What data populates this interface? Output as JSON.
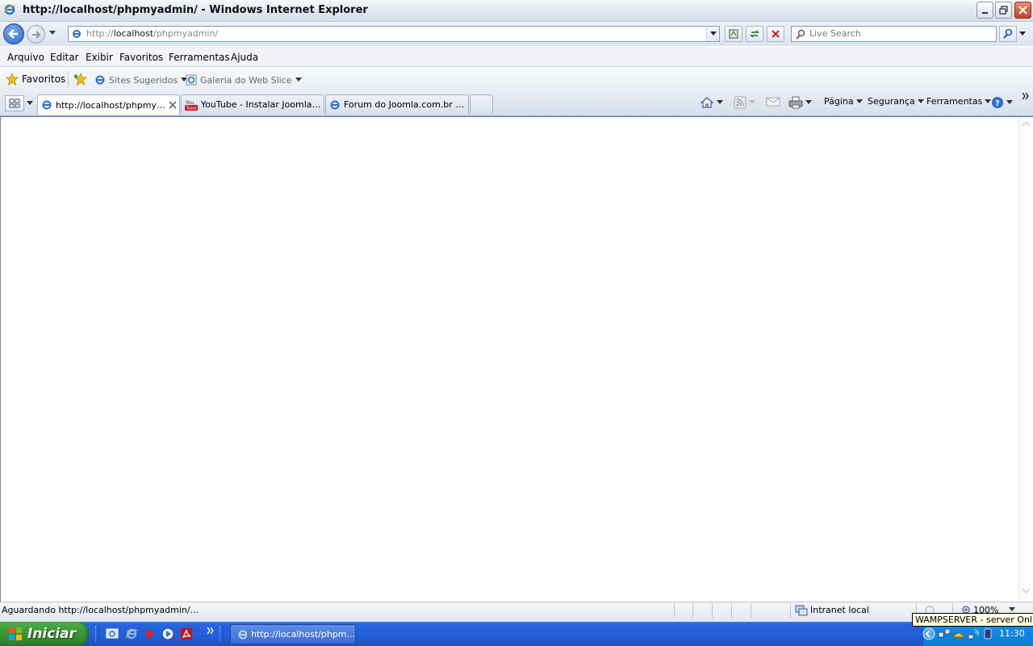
{
  "window": {
    "title": "http://localhost/phpmyadmin/ - Windows Internet Explorer"
  },
  "address": {
    "prefix": "http://",
    "host": "localhost",
    "path": "/phpmyadmin/"
  },
  "search": {
    "placeholder": "Live Search"
  },
  "menu": [
    "Arquivo",
    "Editar",
    "Exibir",
    "Favoritos",
    "Ferramentas",
    "Ajuda"
  ],
  "favorites_bar": {
    "favorites_label": "Favoritos",
    "suggested_sites": "Sites Sugeridos",
    "web_slice_gallery": "Galeria do Web Slice"
  },
  "tabs": [
    {
      "title": "http://localhost/phpmyad...",
      "active": true
    },
    {
      "title": "YouTube - Instalar Joomla no...",
      "active": false
    },
    {
      "title": "Forum do Joomla.com.br • V...",
      "active": false
    }
  ],
  "command_bar": {
    "page": "Página",
    "security": "Segurança",
    "tools": "Ferramentas"
  },
  "status": {
    "text": "Aguardando http://localhost/phpmyadmin/...",
    "zone": "Intranet local",
    "zoom": "100%"
  },
  "taskbar": {
    "start_label": "Iniciar",
    "task_label": "http://localhost/phpm...",
    "clock": "11:30",
    "tooltip": "WAMPSERVER - server Online"
  },
  "colors": {
    "taskbar_blue": "#245edb",
    "start_green": "#3c9a39",
    "tray_blue": "#0c7bd6"
  }
}
